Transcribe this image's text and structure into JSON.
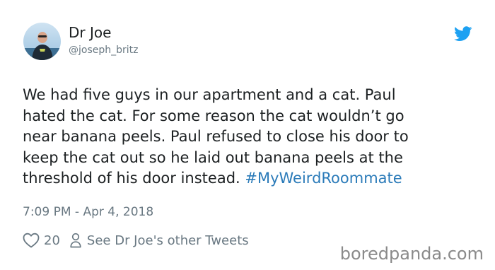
{
  "author": {
    "name": "Dr Joe",
    "handle": "@joseph_britz"
  },
  "tweet": {
    "lines": [
      "We had five guys in our apartment and a cat. Paul",
      "hated the cat. For some reason the cat wouldn’t go",
      "near banana peels. Paul refused to close his door to",
      "keep the cat out so he laid out banana peels at the"
    ],
    "last_line_text": "threshold of his door instead. ",
    "hashtag": "#MyWeirdRoommate",
    "timestamp": "7:09 PM - Apr 4, 2018"
  },
  "actions": {
    "like_count": "20",
    "other_tweets_label": "See Dr Joe's other Tweets"
  },
  "watermark": "boredpanda.com",
  "colors": {
    "text": "#1c2022",
    "muted": "#697882",
    "link": "#2b7bb9",
    "twitter_blue": "#1da1f2"
  },
  "icons": {
    "brand": "twitter-bird-icon",
    "like": "heart-outline-icon",
    "profile": "person-outline-icon"
  }
}
